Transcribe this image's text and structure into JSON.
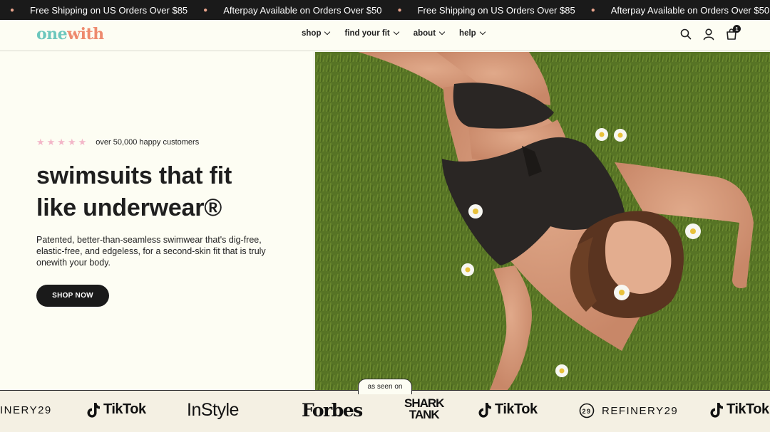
{
  "announcement": {
    "messages": [
      "Free Shipping on US Orders Over $85",
      "Afterpay Available on Orders Over $50",
      "Free Shipping on US Orders Over $85",
      "Afterpay Available on Orders Over $50"
    ]
  },
  "header": {
    "logo_part1": "one",
    "logo_part2": "with",
    "nav": [
      {
        "label": "shop"
      },
      {
        "label": "find your fit"
      },
      {
        "label": "about"
      },
      {
        "label": "help"
      }
    ],
    "cart_count": "1",
    "icons": [
      "search-icon",
      "account-icon",
      "cart-icon"
    ]
  },
  "hero": {
    "stars": "★★★★★",
    "rating_text": "over 50,000 happy customers",
    "headline_line1": "swimsuits that fit",
    "headline_line2": "like underwear®",
    "subcopy": "Patented, better-than-seamless swimwear that's dig-free, elastic-free, and edgeless, for a second-skin fit that is truly onewith your body.",
    "cta_label": "SHOP NOW"
  },
  "press": {
    "label": "as seen on",
    "logos": [
      "INERY29",
      "TikTok",
      "InStyle",
      "Forbes",
      "SHARK",
      "TANK",
      "TikTok",
      "REFINERY29",
      "TikTok"
    ]
  },
  "colors": {
    "announcement_bg": "#1a1a1a",
    "page_bg": "#fdfdf3",
    "logo_teal": "#6cc7bd",
    "logo_coral": "#ee8a6e",
    "star_pink": "#f3b6c8",
    "button_bg": "#1a1a1a"
  }
}
